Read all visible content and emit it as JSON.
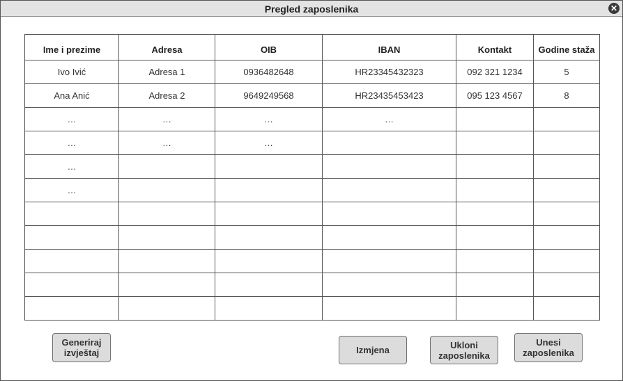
{
  "window": {
    "title": "Pregled zaposlenika",
    "close_glyph": "✕"
  },
  "table": {
    "columns": [
      "Ime i prezime",
      "Adresa",
      "OIB",
      "IBAN",
      "Kontakt",
      "Godine staža"
    ],
    "rows": [
      [
        "Ivo Ivić",
        "Adresa 1",
        "0936482648",
        "HR23345432323",
        "092 321 1234",
        "5"
      ],
      [
        "Ana Anić",
        "Adresa 2",
        "9649249568",
        "HR23435453423",
        "095 123 4567",
        "8"
      ],
      [
        "…",
        "…",
        "…",
        "…",
        "",
        ""
      ],
      [
        "…",
        "…",
        "…",
        "",
        "",
        ""
      ],
      [
        "…",
        "",
        "",
        "",
        "",
        ""
      ],
      [
        "…",
        "",
        "",
        "",
        "",
        ""
      ],
      [
        "",
        "",
        "",
        "",
        "",
        ""
      ],
      [
        "",
        "",
        "",
        "",
        "",
        ""
      ],
      [
        "",
        "",
        "",
        "",
        "",
        ""
      ],
      [
        "",
        "",
        "",
        "",
        "",
        ""
      ],
      [
        "",
        "",
        "",
        "",
        "",
        ""
      ]
    ]
  },
  "buttons": {
    "generate_report": [
      "Generiraj",
      "izvještaj"
    ],
    "edit": "Izmjena",
    "remove_employee": [
      "Ukloni",
      "zaposlenika"
    ],
    "add_employee": [
      "Unesi",
      "zaposlenika"
    ]
  }
}
